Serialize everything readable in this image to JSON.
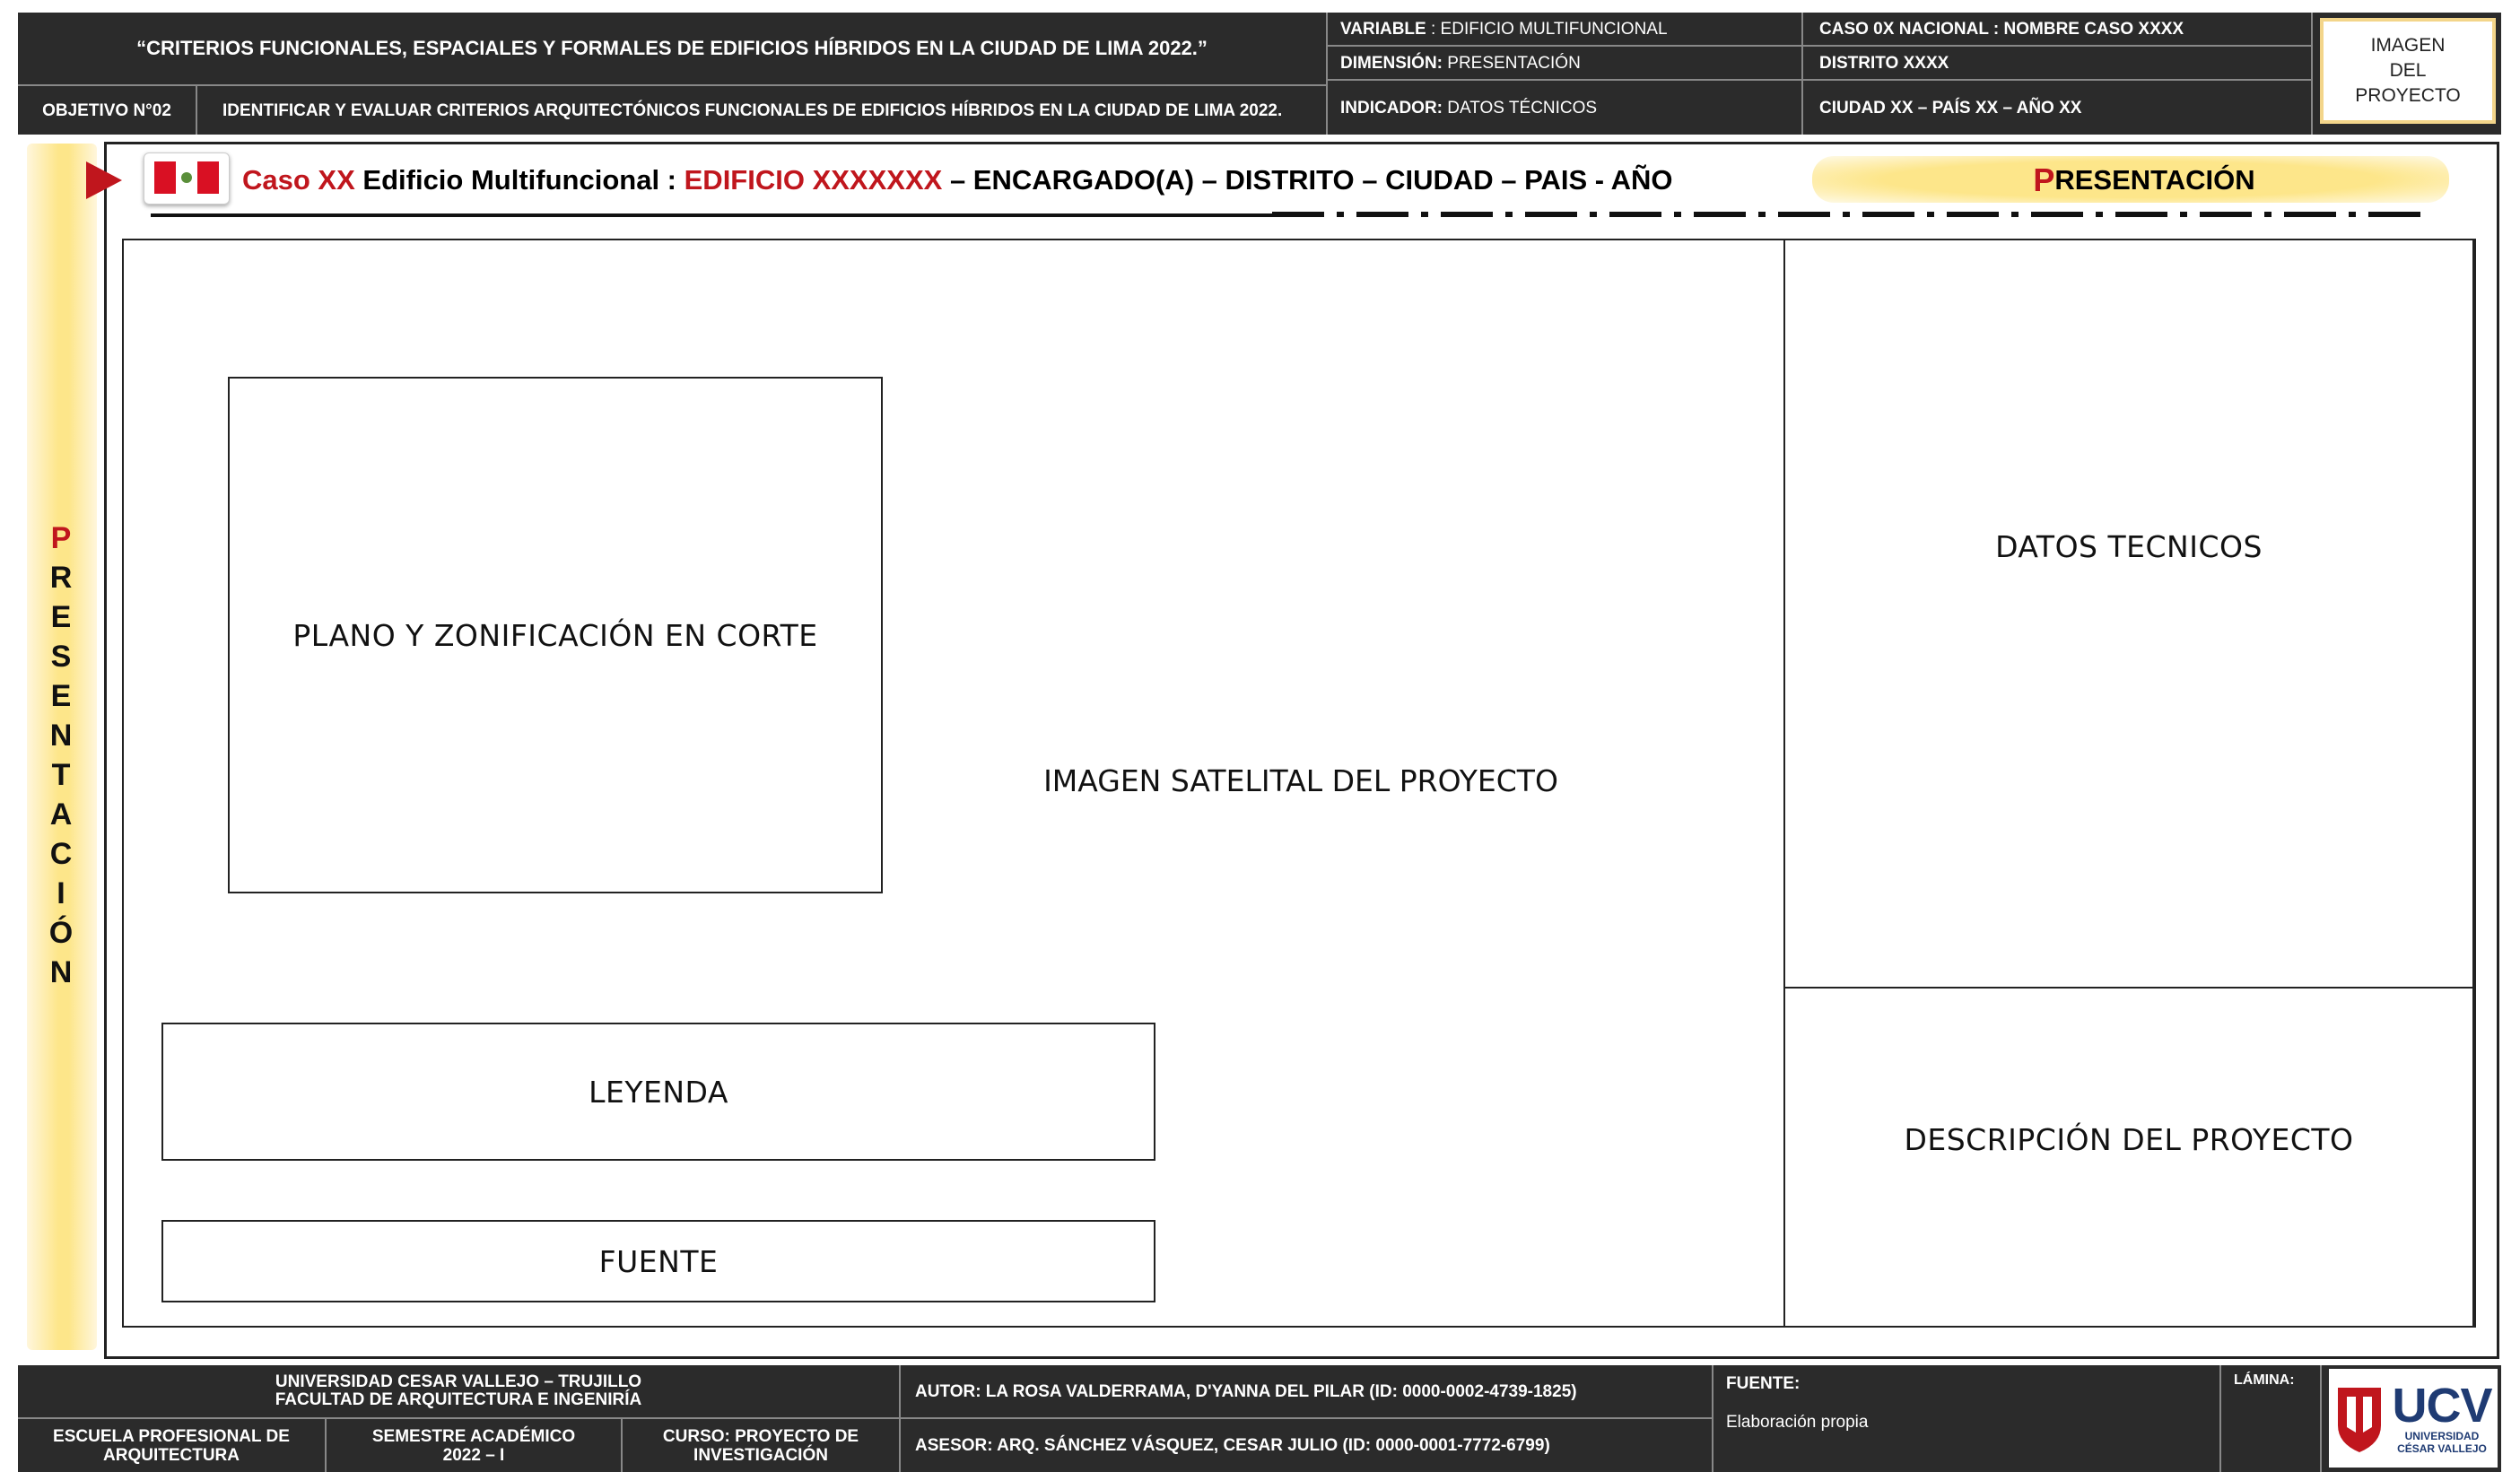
{
  "header": {
    "title": "“CRITERIOS FUNCIONALES, ESPACIALES Y FORMALES DE EDIFICIOS HÍBRIDOS EN LA CIUDAD DE LIMA 2022.”",
    "objective_label": "OBJETIVO N°02",
    "objective_text": "IDENTIFICAR Y EVALUAR CRITERIOS ARQUITECTÓNICOS FUNCIONALES DE EDIFICIOS HÍBRIDOS EN LA CIUDAD DE LIMA 2022.",
    "variable_label": "VARIABLE",
    "variable_value": ": EDIFICIO MULTIFUNCIONAL",
    "dimension_label": "DIMENSIÓN:",
    "dimension_value": "PRESENTACIÓN",
    "indicator_label": "INDICADOR:",
    "indicator_value": "DATOS TÉCNICOS",
    "case_label": "CASO 0X NACIONAL :",
    "case_value": "NOMBRE CASO XXXX",
    "district": "DISTRITO XXXX",
    "location": "CIUDAD XX – PAÍS XX – AÑO XX",
    "project_image_label": "IMAGEN DEL PROYECTO"
  },
  "case_bar": {
    "case_text": "Caso XX",
    "building_type": "Edificio Multifuncional :",
    "building_name": "EDIFICIO XXXXXXX",
    "details": "– ENCARGADO(A) – DISTRITO – CIUDAD – PAIS - AÑO",
    "section_first": "P",
    "section_rest": "RESENTACIÓN"
  },
  "side_label": [
    "P",
    "R",
    "E",
    "S",
    "E",
    "N",
    "T",
    "A",
    "C",
    "I",
    "Ó",
    "N"
  ],
  "panels": {
    "plan": "PLANO Y ZONIFICACIÓN EN CORTE",
    "satellite": "IMAGEN SATELITAL DEL PROYECTO",
    "legend": "LEYENDA",
    "source": "FUENTE",
    "technical": "DATOS TECNICOS",
    "description": "DESCRIPCIÓN DEL PROYECTO"
  },
  "footer": {
    "university": "UNIVERSIDAD CESAR VALLEJO – TRUJILLO",
    "faculty": "FACULTAD DE ARQUITECTURA E INGENIRÍA",
    "school": "ESCUELA PROFESIONAL DE ARQUITECTURA",
    "semester": "SEMESTRE ACADÉMICO 2022 – I",
    "course": "CURSO: PROYECTO DE INVESTIGACIÓN",
    "author": "AUTOR: LA ROSA VALDERRAMA, D'YANNA DEL PILAR (ID: 0000-0002-4739-1825)",
    "advisor": "ASESOR: ARQ. SÁNCHEZ VÁSQUEZ, CESAR JULIO (ID: 0000-0001-7772-6799)",
    "source_label": "FUENTE:",
    "source_value": "Elaboración propia",
    "sheet_label": "LÁMINA:",
    "logo_text": "UCV",
    "logo_sub1": "UNIVERSIDAD",
    "logo_sub2": "CÉSAR VALLEJO"
  },
  "colors": {
    "dark": "#2b2b2b",
    "accent_red": "#c0161d",
    "highlight_yellow": "#fde68a",
    "frame_border": "#222222"
  }
}
